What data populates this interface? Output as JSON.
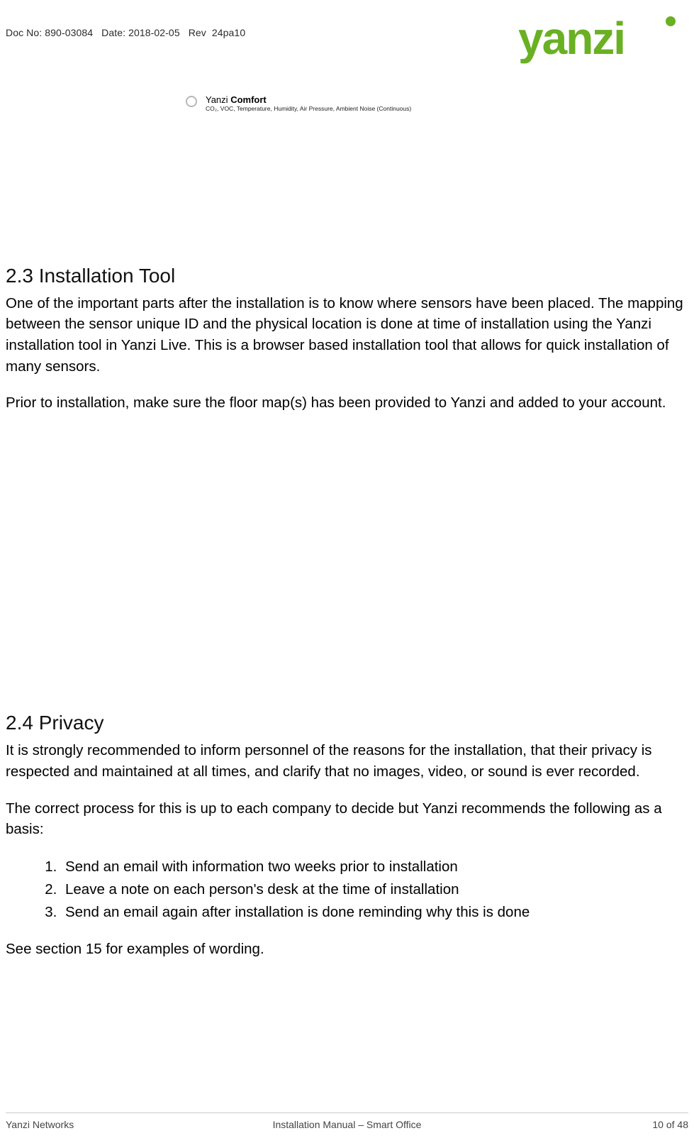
{
  "header": {
    "doc_no_label": "Doc No:",
    "doc_no": "890-03084",
    "date_label": "Date:",
    "date": "2018-02-05",
    "rev_label": "Rev",
    "rev": "24pa10",
    "logo_text": "yanzi"
  },
  "product": {
    "brand": "Yanzi",
    "name": "Comfort",
    "subtitle": "CO₂, VOC, Temperature, Humidity, Air Pressure, Ambient Noise (Continuous)"
  },
  "sections": {
    "s23": {
      "heading": "2.3 Installation Tool",
      "p1": "One of the important parts after the installation is to know where sensors have been placed. The mapping between the sensor unique ID and the physical location is done at time of installation using the Yanzi installation tool in Yanzi Live. This is a browser based installation tool that allows for quick installation of many sensors.",
      "p2": "Prior to installation, make sure the floor map(s) has been provided to Yanzi and added to your account."
    },
    "s24": {
      "heading": "2.4 Privacy",
      "p1": "It is strongly recommended to inform personnel of the reasons for the installation, that their privacy is respected and maintained at all times, and clarify that no images, video, or sound is ever recorded.",
      "p2": "The correct process for this is up to each company to decide but Yanzi recommends the following as a basis:",
      "steps": [
        "Send an email with information two weeks prior to installation",
        "Leave a note on each person's desk at the time of installation",
        "Send an email again after installation is done reminding why this is done"
      ],
      "p3": "See section 15 for examples of wording."
    }
  },
  "footer": {
    "left": "Yanzi Networks",
    "center": "Installation Manual – Smart Office",
    "right": "10 of 48"
  }
}
